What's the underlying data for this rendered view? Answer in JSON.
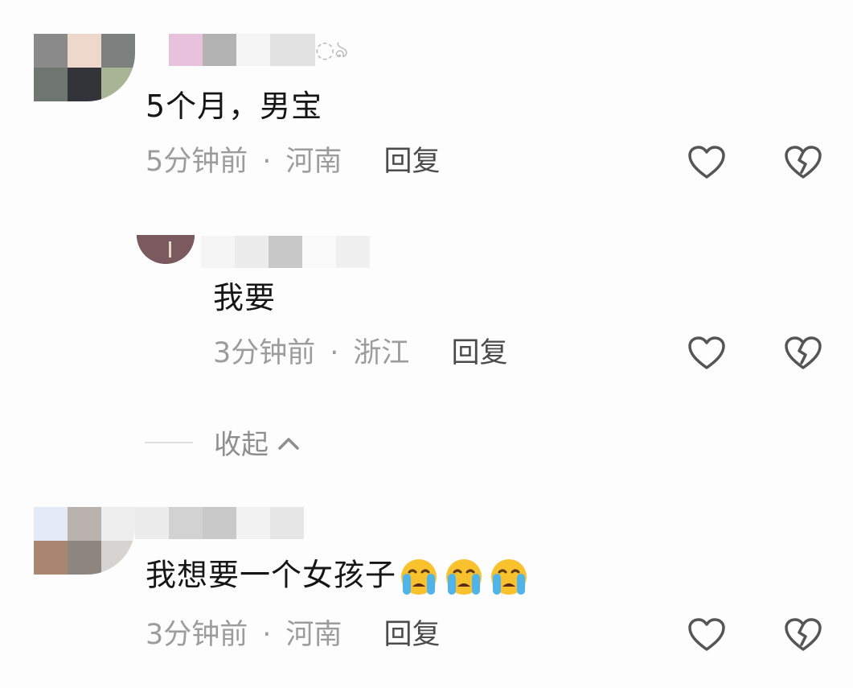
{
  "comments": [
    {
      "text": "5个月，男宝",
      "time": "5分钟前",
      "separator": "·",
      "location": "河南",
      "reply_label": "回复"
    },
    {
      "text": "我要",
      "time": "3分钟前",
      "separator": "·",
      "location": "浙江",
      "reply_label": "回复"
    },
    {
      "text": "我想要一个女孩子",
      "time": "3分钟前",
      "separator": "·",
      "location": "河南",
      "reply_label": "回复",
      "emojis": [
        "loudly-crying-face",
        "loudly-crying-face",
        "loudly-crying-face"
      ]
    }
  ],
  "collapse_label": "收起",
  "icons": {
    "like": "heart-outline-icon",
    "dislike": "broken-heart-icon",
    "collapse": "chevron-up-icon"
  },
  "colors": {
    "text_primary": "#161616",
    "text_meta": "#9c9c9c",
    "reply_text": "#4b4b4b",
    "icon_stroke": "#555555"
  }
}
